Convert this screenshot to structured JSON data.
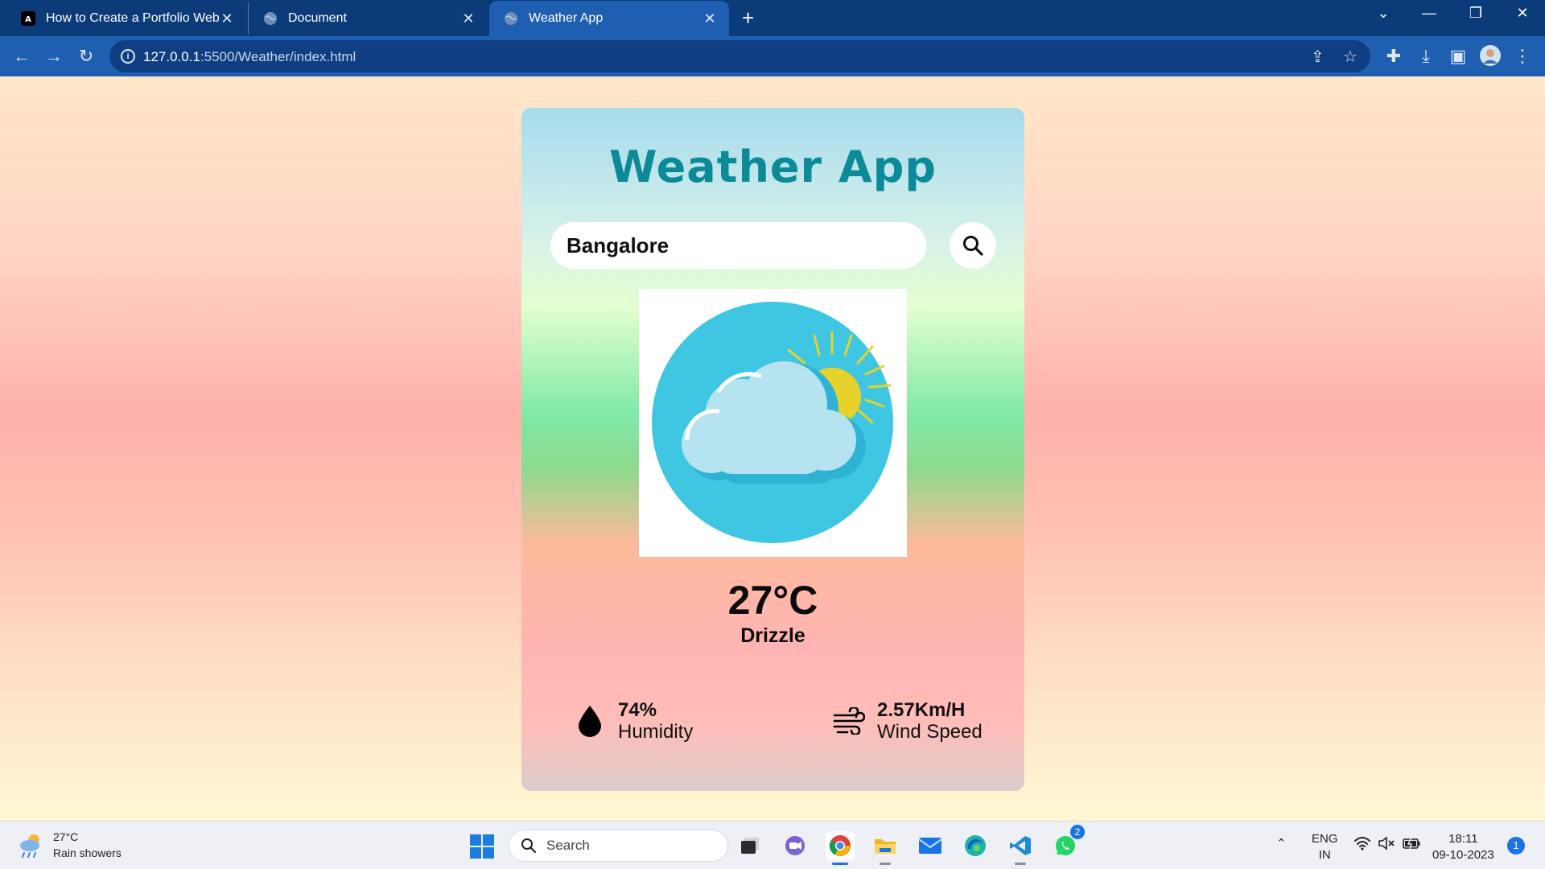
{
  "browser": {
    "tabs": [
      {
        "title": "How to Create a Portfolio Websi",
        "favicon": "ai-logo-icon",
        "active": false
      },
      {
        "title": "Document",
        "favicon": "globe-icon",
        "active": false
      },
      {
        "title": "Weather App",
        "favicon": "globe-icon",
        "active": true
      }
    ],
    "url_host": "127.0.0.1",
    "url_path": ":5500/Weather/index.html"
  },
  "app": {
    "title": "Weather App",
    "search": {
      "value": "Bangalore",
      "placeholder": ""
    },
    "weather_icon": "sun-behind-cloud",
    "temperature": "27°C",
    "condition": "Drizzle",
    "humidity": {
      "value": "74%",
      "label": "Humidity"
    },
    "wind": {
      "value": "2.57Km/H",
      "label": "Wind Speed"
    }
  },
  "taskbar": {
    "weather": {
      "temp": "27°C",
      "desc": "Rain showers"
    },
    "search_label": "Search",
    "whatsapp_badge": "2",
    "language": {
      "line1": "ENG",
      "line2": "IN"
    },
    "time": "18:11",
    "date": "09-10-2023",
    "notifications": "1"
  },
  "colors": {
    "title": "#0c8a98",
    "tab_bar": "#0b3b78",
    "toolbar": "#1f5fb2",
    "sky_circle": "#3ec6e2",
    "sun": "#e6d22a"
  }
}
